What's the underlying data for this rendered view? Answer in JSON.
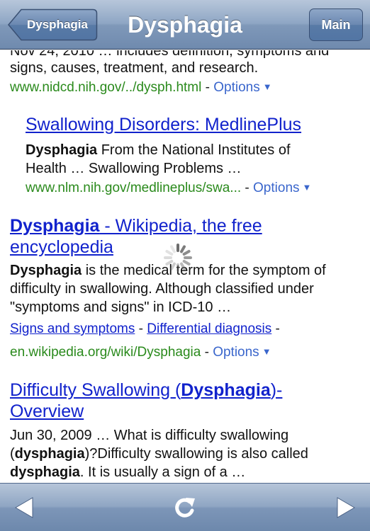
{
  "navbar": {
    "back_label": "Dysphagia",
    "title": "Dysphagia",
    "main_label": "Main"
  },
  "results": {
    "r1": {
      "snippet_line1": "Nov 24, 2010 … includes definition, symptoms and",
      "snippet_line2": "signs, causes, treatment, and research.",
      "url": "www.nidcd.nih.gov/../dysph.html"
    },
    "r2": {
      "title": "Swallowing Disorders: MedlinePlus",
      "snippet_bold": "Dysphagia",
      "snippet_line1_rest": " From the National Institutes of",
      "snippet_line2": "Health … Swallowing Problems …",
      "url": "www.nlm.nih.gov/medlineplus/swa..."
    },
    "r3": {
      "title_bold": "Dysphagia",
      "title_rest": " - Wikipedia, the free",
      "title_line2": "encyclopedia",
      "snippet_bold": "Dysphagia",
      "snippet_line1_rest": " is the medical term for the symptom of",
      "snippet_line2": "difficulty in swallowing. Although classified under",
      "snippet_line3": "\"symptoms and signs\" in ICD-10 …",
      "sitelink1": "Signs and symptoms",
      "sitelink2": "Differential diagnosis",
      "separator": " - ",
      "url": "en.wikipedia.org/wiki/Dysphagia"
    },
    "r4": {
      "title_part1": "Difficulty Swallowing (",
      "title_bold": "Dysphagia",
      "title_part2": ")-",
      "title_line2": "Overview",
      "snippet_line1": "Jun 30, 2009 … What is difficulty swallowing",
      "snippet_line2_pre": "(",
      "snippet_line2_bold": "dysphagia",
      "snippet_line2_rest": ")?Difficulty swallowing is also called",
      "snippet_line3_bold": "dysphagia",
      "snippet_line3_rest": ". It is usually a sign of a …"
    },
    "options_label": "Options",
    "url_separator": " - "
  },
  "toolbar": {
    "back_icon": "left-arrow-icon",
    "reload_icon": "reload-icon",
    "forward_icon": "right-arrow-icon"
  },
  "colors": {
    "link": "#1122cc",
    "url_green": "#2a8a1c",
    "options_blue": "#3a66cc",
    "navbar": "#7f98b9"
  }
}
